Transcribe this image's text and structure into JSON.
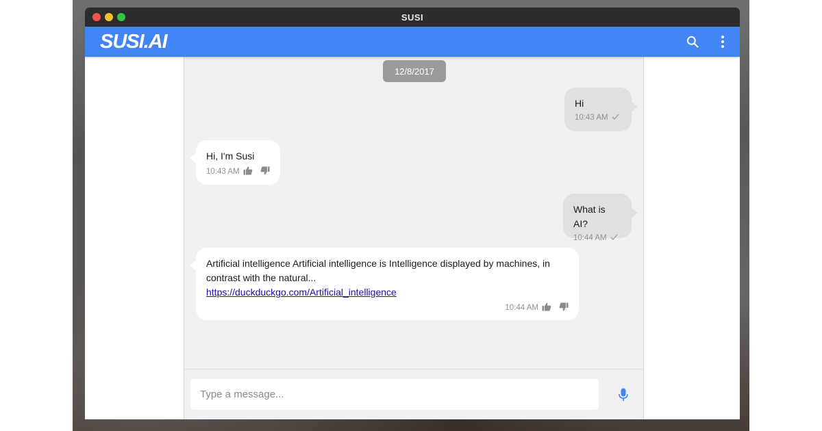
{
  "window": {
    "title": "SUSI"
  },
  "appbar": {
    "logo_text": "SUSI.AI",
    "search_icon": "search-icon",
    "menu_icon": "more-vert-icon"
  },
  "chat": {
    "date_chip": "12/8/2017",
    "messages": [
      {
        "from": "user",
        "text": "Hi",
        "time": "10:43 AM",
        "status_icon": "check-icon"
      },
      {
        "from": "susi",
        "text": "Hi, I'm Susi",
        "time": "10:43 AM"
      },
      {
        "from": "user",
        "text": "What is AI?",
        "time": "10:44 AM",
        "status_icon": "check-icon"
      },
      {
        "from": "susi",
        "text": "Artificial intelligence Artificial intelligence is Intelligence displayed by machines, in contrast with the natural...",
        "link": "https://duckduckgo.com/Artificial_intelligence",
        "time": "10:44 AM"
      }
    ]
  },
  "composer": {
    "placeholder": "Type a message...",
    "mic_icon": "mic-icon"
  },
  "colors": {
    "accent": "#4285f4",
    "titlebar": "#2c2c2c",
    "chat_bg": "#f1f1f3",
    "sent_bubble": "#e0e0e2",
    "date_chip": "#9b9b9b"
  }
}
